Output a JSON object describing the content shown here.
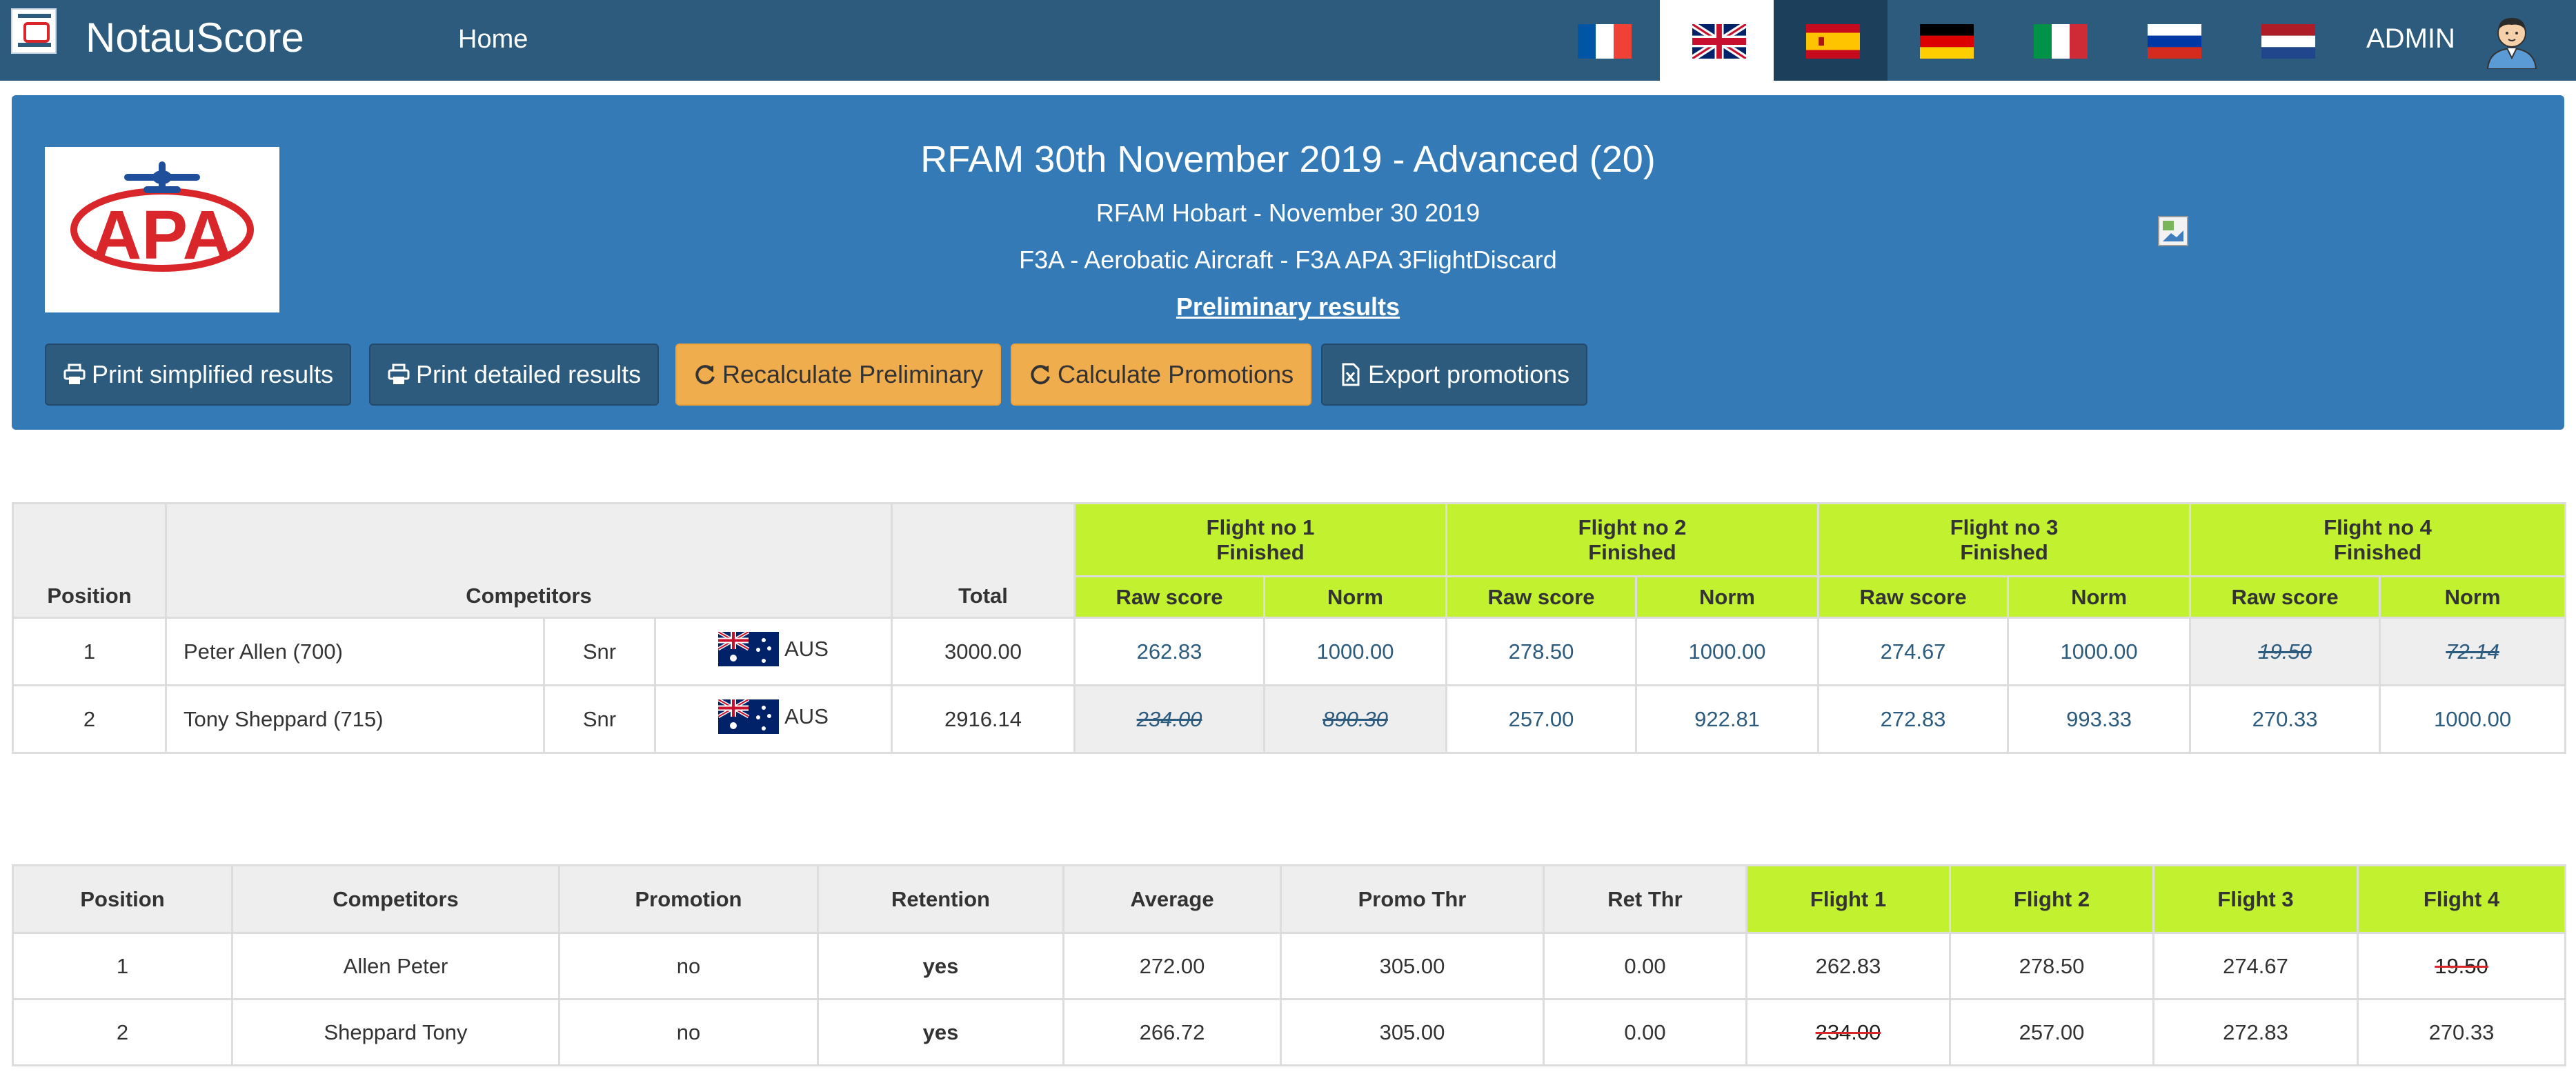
{
  "navbar": {
    "brand": "NotauScore",
    "home": "Home",
    "admin": "ADMIN",
    "languages": [
      "fr",
      "en",
      "es",
      "de",
      "it",
      "ru",
      "nl"
    ],
    "active_language": "en"
  },
  "event": {
    "title": "RFAM 30th November 2019 - Advanced (20)",
    "subtitle": "RFAM Hobart - November 30 2019",
    "class": "F3A - Aerobatic Aircraft - F3A APA 3FlightDiscard",
    "results_link": "Preliminary results",
    "logo_text": "APA"
  },
  "buttons": {
    "print_simplified": "Print simplified results",
    "print_detailed": "Print detailed results",
    "recalculate": "Recalculate Preliminary",
    "calculate_promotions": "Calculate Promotions",
    "export_promotions": "Export promotions"
  },
  "results": {
    "headers": {
      "position": "Position",
      "competitors": "Competitors",
      "total": "Total",
      "raw": "Raw score",
      "norm": "Norm"
    },
    "flights": [
      {
        "name": "Flight no 1",
        "status": "Finished"
      },
      {
        "name": "Flight no 2",
        "status": "Finished"
      },
      {
        "name": "Flight no 3",
        "status": "Finished"
      },
      {
        "name": "Flight no 4",
        "status": "Finished"
      }
    ],
    "rows": [
      {
        "position": "1",
        "name": "Peter Allen (700)",
        "category": "Snr",
        "country": "AUS",
        "total": "3000.00",
        "scores": [
          "262.83",
          "1000.00",
          "278.50",
          "1000.00",
          "274.67",
          "1000.00",
          "19.50",
          "72.14"
        ],
        "discarded_flight": 4
      },
      {
        "position": "2",
        "name": "Tony Sheppard (715)",
        "category": "Snr",
        "country": "AUS",
        "total": "2916.14",
        "scores": [
          "234.00",
          "890.30",
          "257.00",
          "922.81",
          "272.83",
          "993.33",
          "270.33",
          "1000.00"
        ],
        "discarded_flight": 1
      }
    ]
  },
  "promotions": {
    "headers": [
      "Position",
      "Competitors",
      "Promotion",
      "Retention",
      "Average",
      "Promo Thr",
      "Ret Thr",
      "Flight 1",
      "Flight 2",
      "Flight 3",
      "Flight 4"
    ],
    "rows": [
      {
        "position": "1",
        "name": "Allen Peter",
        "promotion": "no",
        "retention": "yes",
        "average": "272.00",
        "promo_thr": "305.00",
        "ret_thr": "0.00",
        "flights": [
          "262.83",
          "278.50",
          "274.67",
          "19.50"
        ],
        "discarded_flight": 4
      },
      {
        "position": "2",
        "name": "Sheppard Tony",
        "promotion": "no",
        "retention": "yes",
        "average": "266.72",
        "promo_thr": "305.00",
        "ret_thr": "0.00",
        "flights": [
          "234.00",
          "257.00",
          "272.83",
          "270.33"
        ],
        "discarded_flight": 1
      }
    ]
  },
  "colors": {
    "navbar": "#2c5b7e",
    "panel": "#337ab7",
    "flight_header": "#c1f12f",
    "button_orange": "#f0ad4e"
  }
}
